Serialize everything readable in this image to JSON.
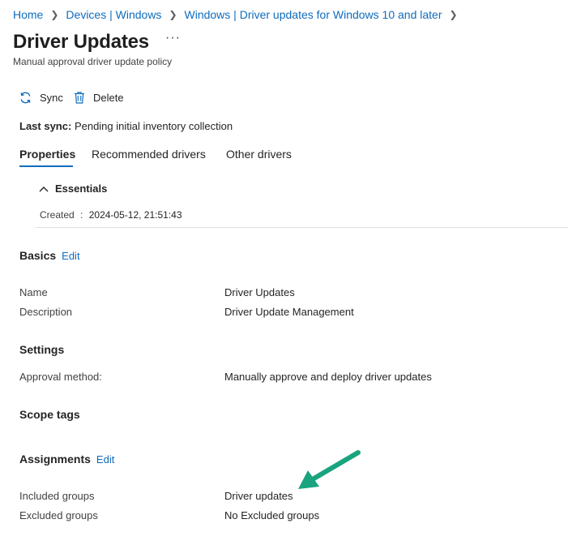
{
  "breadcrumb": {
    "items": [
      "Home",
      "Devices | Windows",
      "Windows | Driver updates for Windows 10 and later"
    ],
    "separator": ">"
  },
  "header": {
    "title": "Driver Updates",
    "more": "···",
    "subtitle": "Manual approval driver update policy"
  },
  "toolbar": {
    "sync_label": "Sync",
    "delete_label": "Delete"
  },
  "last_sync": {
    "label": "Last sync:",
    "value": "Pending initial inventory collection"
  },
  "tabs": [
    {
      "label": "Properties",
      "active": true
    },
    {
      "label": "Recommended drivers",
      "active": false
    },
    {
      "label": "Other drivers",
      "active": false
    }
  ],
  "essentials": {
    "title": "Essentials",
    "created_label": "Created",
    "created_sep": ":",
    "created_value": "2024-05-12, 21:51:43"
  },
  "basics": {
    "title": "Basics",
    "edit": "Edit",
    "rows": [
      {
        "label": "Name",
        "value": "Driver Updates"
      },
      {
        "label": "Description",
        "value": "Driver Update Management"
      }
    ]
  },
  "settings": {
    "title": "Settings",
    "rows": [
      {
        "label": "Approval method:",
        "value": "Manually approve and deploy driver updates"
      }
    ]
  },
  "scope_tags": {
    "title": "Scope tags"
  },
  "assignments": {
    "title": "Assignments",
    "edit": "Edit",
    "rows": [
      {
        "label": "Included groups",
        "value": "Driver updates"
      },
      {
        "label": "Excluded groups",
        "value": "No Excluded groups"
      }
    ]
  },
  "colors": {
    "accent": "#0f6cbd",
    "arrow": "#19a37e",
    "text": "#242424"
  }
}
